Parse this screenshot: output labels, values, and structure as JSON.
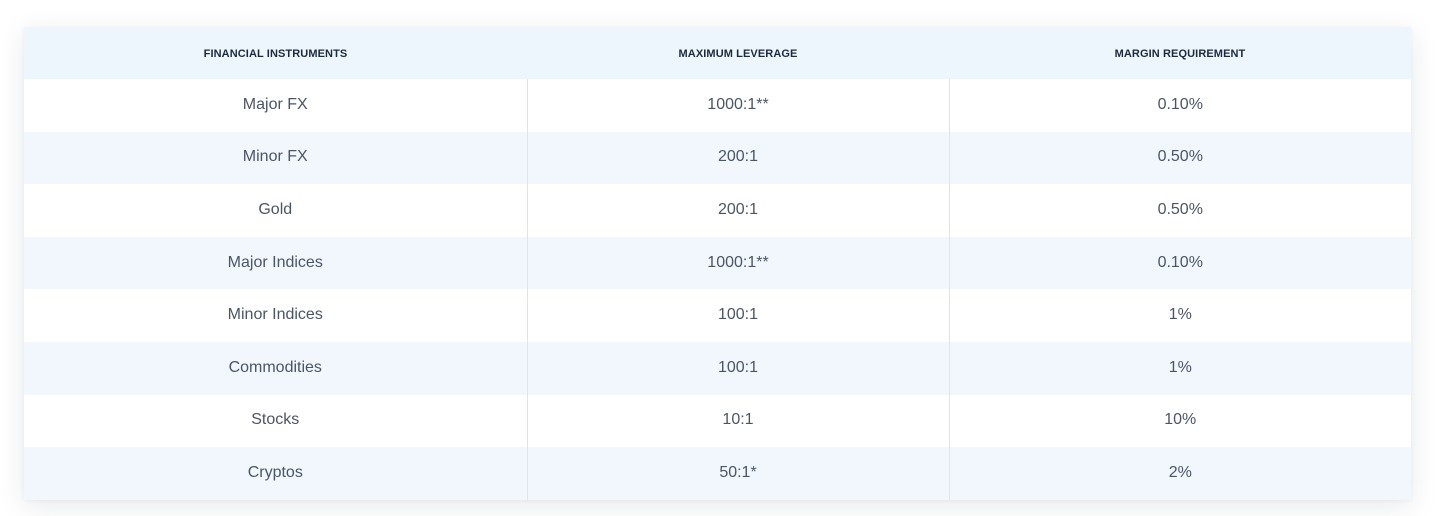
{
  "table": {
    "headers": [
      "FINANCIAL INSTRUMENTS",
      "MAXIMUM LEVERAGE",
      "MARGIN REQUIREMENT"
    ],
    "rows": [
      [
        "Major FX",
        "1000:1**",
        "0.10%"
      ],
      [
        "Minor FX",
        "200:1",
        "0.50%"
      ],
      [
        "Gold",
        "200:1",
        "0.50%"
      ],
      [
        "Major Indices",
        "1000:1**",
        "0.10%"
      ],
      [
        "Minor Indices",
        "100:1",
        "1%"
      ],
      [
        "Commodities",
        "100:1",
        "1%"
      ],
      [
        "Stocks",
        "10:1",
        "10%"
      ],
      [
        "Cryptos",
        "50:1*",
        "2%"
      ]
    ]
  },
  "colors": {
    "header_bg": "#eef6fd",
    "row_alt_bg": "#f1f7fd",
    "header_text": "#1b2a3d",
    "cell_text": "#4b5563",
    "divider": "#d6e6f4"
  }
}
